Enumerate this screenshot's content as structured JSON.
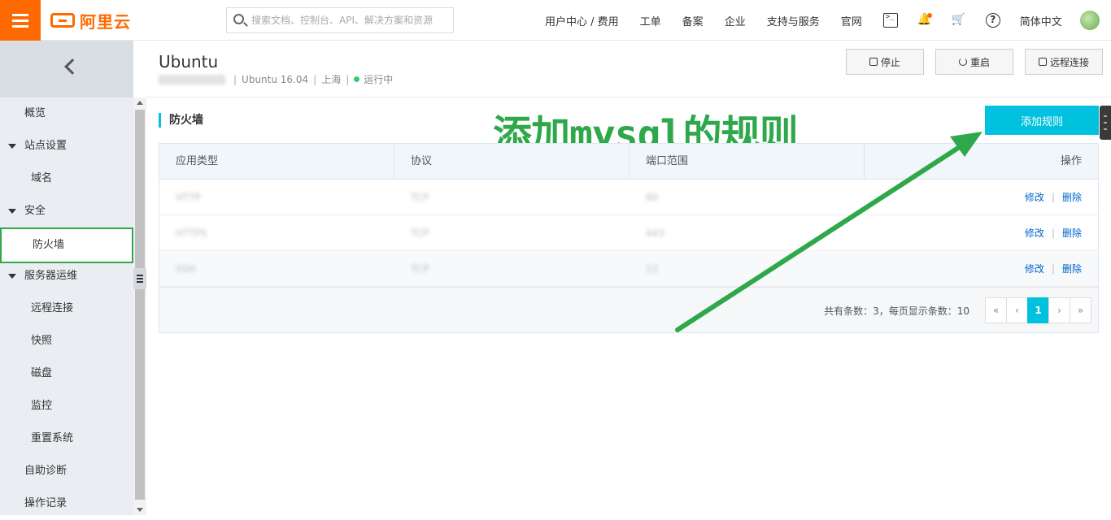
{
  "topbar": {
    "brand": "阿里云",
    "search_placeholder": "搜索文档、控制台、API、解决方案和资源",
    "nav": [
      "用户中心 / 费用",
      "工单",
      "备案",
      "企业",
      "支持与服务",
      "官网"
    ],
    "language": "简体中文",
    "icons": [
      "menu-icon",
      "terminal-icon",
      "bell-icon",
      "cart-icon",
      "help-icon",
      "avatar"
    ],
    "brand_color": "#ff6a00"
  },
  "sidebar": {
    "items": [
      {
        "label": "概览",
        "type": "item"
      },
      {
        "label": "站点设置",
        "type": "group"
      },
      {
        "label": "域名",
        "type": "sub"
      },
      {
        "label": "安全",
        "type": "group"
      },
      {
        "label": "防火墙",
        "type": "sub",
        "active": true
      },
      {
        "label": "服务器运维",
        "type": "group"
      },
      {
        "label": "远程连接",
        "type": "sub"
      },
      {
        "label": "快照",
        "type": "sub"
      },
      {
        "label": "磁盘",
        "type": "sub"
      },
      {
        "label": "监控",
        "type": "sub"
      },
      {
        "label": "重置系统",
        "type": "sub"
      },
      {
        "label": "自助诊断",
        "type": "item"
      },
      {
        "label": "操作记录",
        "type": "item"
      }
    ]
  },
  "instance": {
    "name": "Ubuntu",
    "os": "Ubuntu 16.04",
    "region": "上海",
    "status": "运行中"
  },
  "header_buttons": {
    "stop": "停止",
    "restart": "重启",
    "remote": "远程连接"
  },
  "section": {
    "title": "防火墙",
    "add_button": "添加规则",
    "accent_color": "#00c1de"
  },
  "annotation": "添加mysql的规则",
  "table": {
    "columns": [
      "应用类型",
      "协议",
      "端口范围",
      "操作"
    ],
    "rows": [
      {
        "app": "HTTP",
        "protocol": "TCP",
        "port": "80",
        "edit": "修改",
        "delete": "删除"
      },
      {
        "app": "HTTPS",
        "protocol": "TCP",
        "port": "443",
        "edit": "修改",
        "delete": "删除"
      },
      {
        "app": "SSH",
        "protocol": "TCP",
        "port": "22",
        "edit": "修改",
        "delete": "删除"
      }
    ],
    "summary": "共有条数：3，每页显示条数：10",
    "pager": [
      "«",
      "‹",
      "1",
      "›",
      "»"
    ],
    "current_page": "1"
  }
}
